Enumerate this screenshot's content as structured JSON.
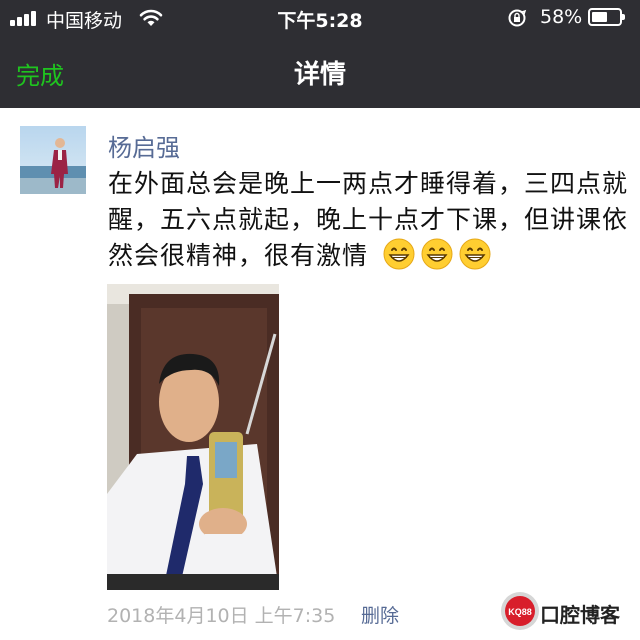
{
  "status_bar": {
    "carrier": "中国移动",
    "time": "下午5:28",
    "battery_percent": "58%",
    "battery_level": 0.58
  },
  "nav": {
    "done_label": "完成",
    "title": "详情"
  },
  "post": {
    "author": "杨启强",
    "text": "在外面总会是晚上一两点才睡得着，三四点就醒，五六点就起，晚上十点才下课，但讲课依然会很精神，很有激情",
    "emojis": [
      "grinning-face",
      "grinning-face",
      "grinning-face"
    ],
    "timestamp": "2018年4月10日 上午7:35",
    "delete_label": "删除"
  },
  "watermark": {
    "badge": "KQ88",
    "text": "口腔博客"
  },
  "colors": {
    "nav_background": "#2e2e33",
    "done_green": "#1fc41f",
    "link_blue": "#576b95",
    "meta_gray": "#b2b2b2"
  },
  "icons": [
    "signal-icon",
    "wifi-icon",
    "orientation-lock-icon",
    "battery-icon",
    "grinning-face-emoji"
  ]
}
